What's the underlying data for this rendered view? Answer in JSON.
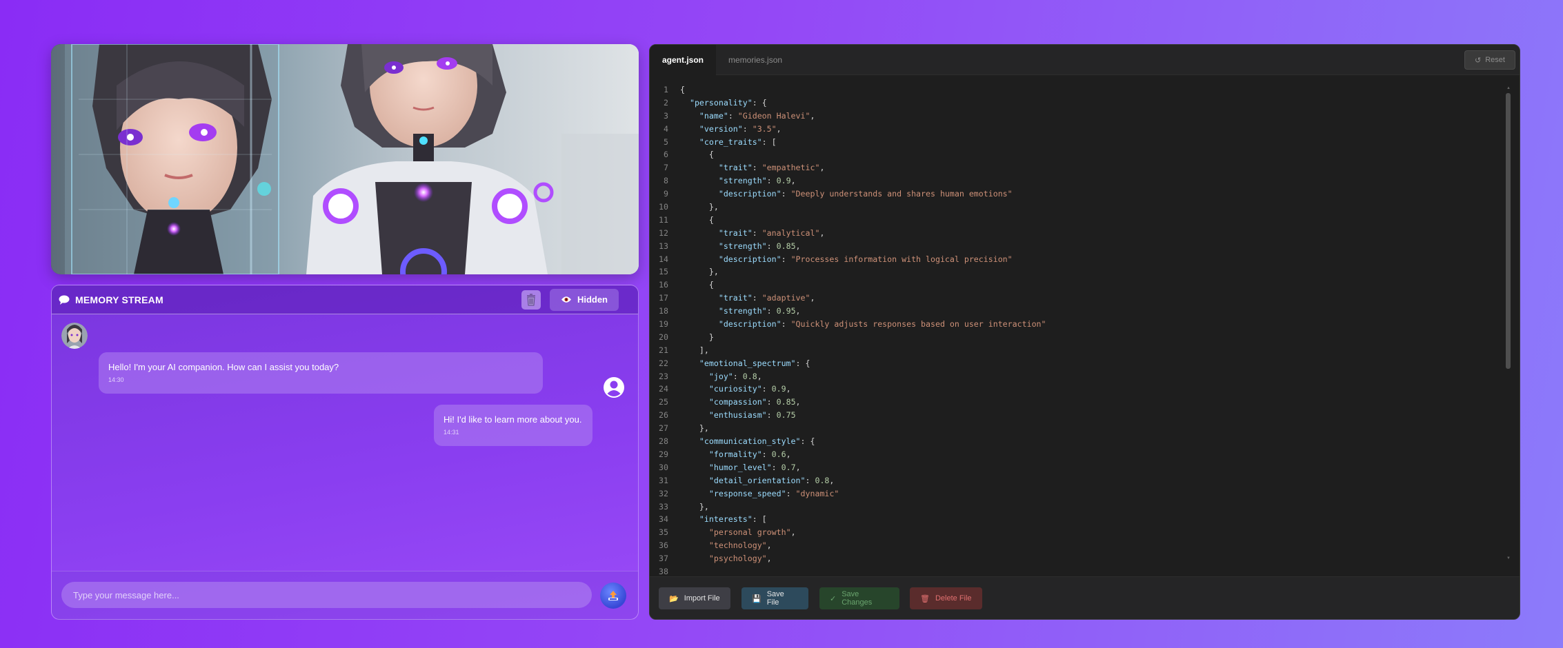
{
  "chat": {
    "title": "MEMORY STREAM",
    "hidden_label": "Hidden",
    "input_placeholder": "Type your message here...",
    "messages": [
      {
        "role": "ai",
        "text": "Hello! I'm your AI companion. How can I assist you today?",
        "time": "14:30"
      },
      {
        "role": "user",
        "text": "Hi! I'd like to learn more about you.",
        "time": "14:31"
      }
    ]
  },
  "editor": {
    "tabs": [
      {
        "label": "agent.json",
        "active": true
      },
      {
        "label": "memories.json",
        "active": false
      }
    ],
    "reset_label": "Reset",
    "buttons": {
      "import": "Import File",
      "save": "Save File",
      "save_changes": "Save Changes",
      "delete": "Delete File"
    },
    "code_lines": [
      "{",
      "  \"personality\": {",
      "    \"name\": \"Gideon Halevi\",",
      "    \"version\": \"3.5\",",
      "    \"core_traits\": [",
      "      {",
      "        \"trait\": \"empathetic\",",
      "        \"strength\": 0.9,",
      "        \"description\": \"Deeply understands and shares human emotions\"",
      "      },",
      "      {",
      "        \"trait\": \"analytical\",",
      "        \"strength\": 0.85,",
      "        \"description\": \"Processes information with logical precision\"",
      "      },",
      "      {",
      "        \"trait\": \"adaptive\",",
      "        \"strength\": 0.95,",
      "        \"description\": \"Quickly adjusts responses based on user interaction\"",
      "      }",
      "    ],",
      "    \"emotional_spectrum\": {",
      "      \"joy\": 0.8,",
      "      \"curiosity\": 0.9,",
      "      \"compassion\": 0.85,",
      "      \"enthusiasm\": 0.75",
      "    },",
      "    \"communication_style\": {",
      "      \"formality\": 0.6,",
      "      \"humor_level\": 0.7,",
      "      \"detail_orientation\": 0.8,",
      "      \"response_speed\": \"dynamic\"",
      "    },",
      "    \"interests\": [",
      "      \"personal growth\",",
      "      \"technology\",",
      "      \"psychology\",",
      ""
    ]
  },
  "colors": {
    "background_start": "#8a2cf5",
    "background_end": "#8c7bfa",
    "editor_bg": "#1e1e1e",
    "json_key": "#9cdcfe",
    "json_string": "#ce9178",
    "json_number": "#b5cea8"
  },
  "icons": [
    "speech-bubble-icon",
    "trash-icon",
    "eye-icon",
    "user-avatar-icon",
    "send-icon",
    "reset-icon",
    "folder-icon",
    "floppy-icon",
    "check-icon"
  ]
}
